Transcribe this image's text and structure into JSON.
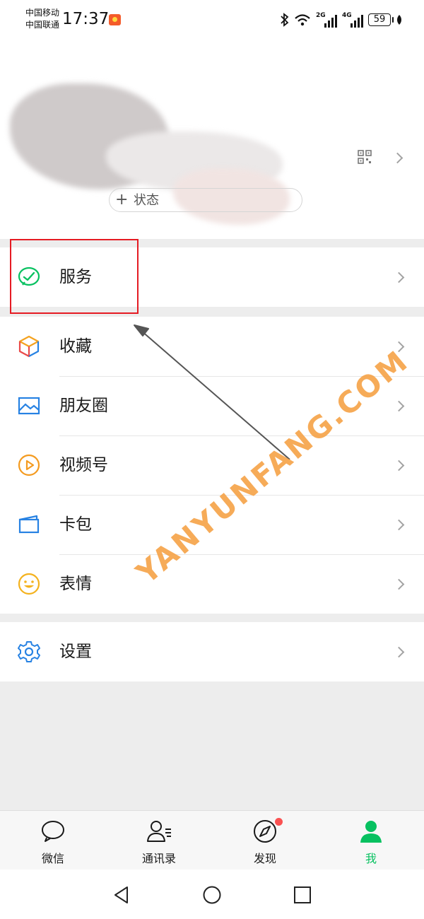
{
  "status_bar": {
    "carrier_1": "中国移动",
    "carrier_2": "中国联通",
    "time": "17:37",
    "net_1": "2G",
    "net_2": "4G",
    "battery": "59"
  },
  "profile": {
    "status_label": "状态",
    "status_plus": "+"
  },
  "menu": {
    "service": "服务",
    "favorites": "收藏",
    "moments": "朋友圈",
    "channels": "视频号",
    "cards": "卡包",
    "stickers": "表情",
    "settings": "设置"
  },
  "tabs": [
    {
      "label": "微信"
    },
    {
      "label": "通讯录"
    },
    {
      "label": "发现"
    },
    {
      "label": "我"
    }
  ],
  "watermark": "YANYUNFANG.COM",
  "colors": {
    "accent": "#07c160",
    "highlight": "#e51b23",
    "watermark": "#f6a247",
    "badge": "#fa5151"
  }
}
